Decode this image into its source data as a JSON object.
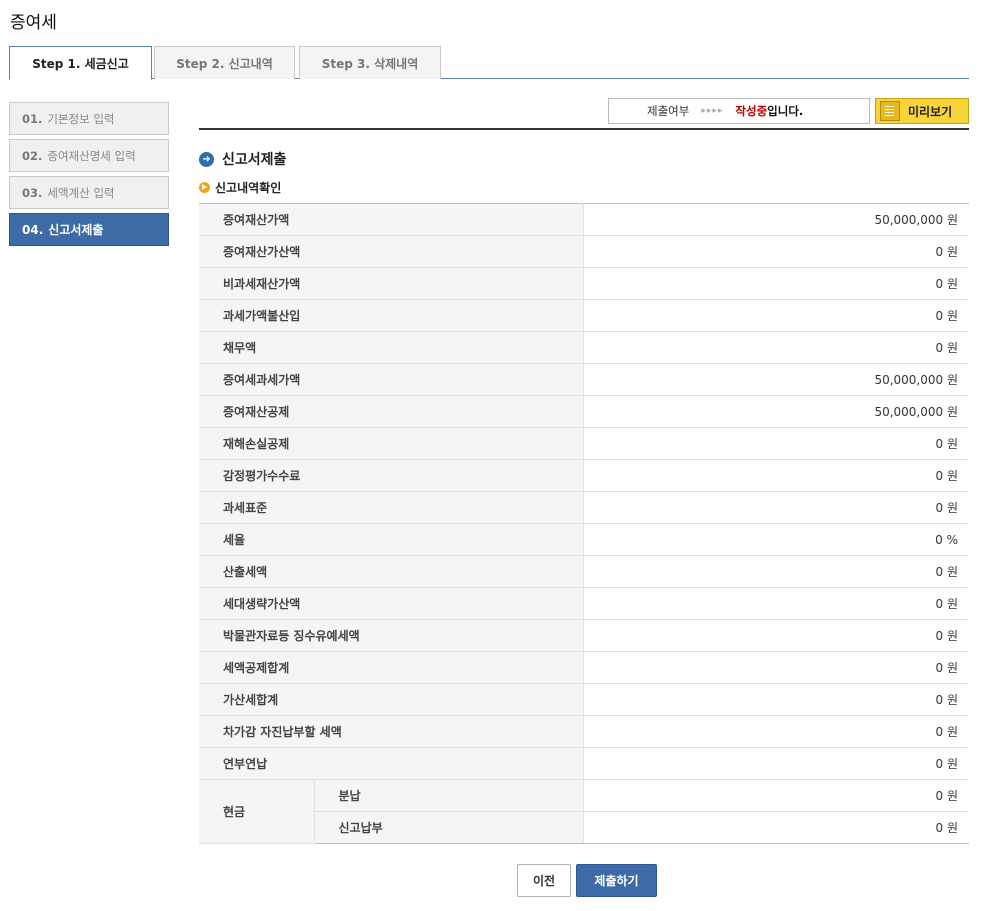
{
  "page": {
    "title": "증여세"
  },
  "tabs": [
    {
      "label": "Step 1. 세금신고",
      "active": true
    },
    {
      "label": "Step 2. 신고내역",
      "active": false
    },
    {
      "label": "Step 3. 삭제내역",
      "active": false
    }
  ],
  "sidebar": [
    {
      "num": "01.",
      "label": "기본정보 입력"
    },
    {
      "num": "02.",
      "label": "증여재산명세 입력"
    },
    {
      "num": "03.",
      "label": "세액계산 입력"
    },
    {
      "num": "04.",
      "label": "신고서제출"
    }
  ],
  "status": {
    "label": "제출여부",
    "arrows": "▸▸▸▸",
    "state_red": "작성중",
    "state_black": "입니다."
  },
  "preview": {
    "label": "미리보기"
  },
  "section": {
    "title": "신고서제출",
    "subtitle": "신고내역확인"
  },
  "rows": [
    {
      "label": "증여재산가액",
      "value": "50,000,000 원"
    },
    {
      "label": "증여재산가산액",
      "value": "0 원"
    },
    {
      "label": "비과세재산가액",
      "value": "0 원"
    },
    {
      "label": "과세가액불산입",
      "value": "0 원"
    },
    {
      "label": "채무액",
      "value": "0 원"
    },
    {
      "label": "증여세과세가액",
      "value": "50,000,000 원"
    },
    {
      "label": "증여재산공제",
      "value": "50,000,000 원"
    },
    {
      "label": "재해손실공제",
      "value": "0 원"
    },
    {
      "label": "감정평가수수료",
      "value": "0 원"
    },
    {
      "label": "과세표준",
      "value": "0 원"
    },
    {
      "label": "세율",
      "value": "0 %"
    },
    {
      "label": "산출세액",
      "value": "0 원"
    },
    {
      "label": "세대생략가산액",
      "value": "0 원"
    },
    {
      "label": "박물관자료등 징수유예세액",
      "value": "0 원"
    },
    {
      "label": "세액공제합계",
      "value": "0 원"
    },
    {
      "label": "가산세합계",
      "value": "0 원"
    },
    {
      "label": "차가감 자진납부할 세액",
      "value": "0 원"
    },
    {
      "label": "연부연납",
      "value": "0 원"
    }
  ],
  "cash": {
    "label": "현금",
    "items": [
      {
        "label": "분납",
        "value": "0 원"
      },
      {
        "label": "신고납부",
        "value": "0 원"
      }
    ]
  },
  "buttons": {
    "prev": "이전",
    "submit": "제출하기"
  }
}
